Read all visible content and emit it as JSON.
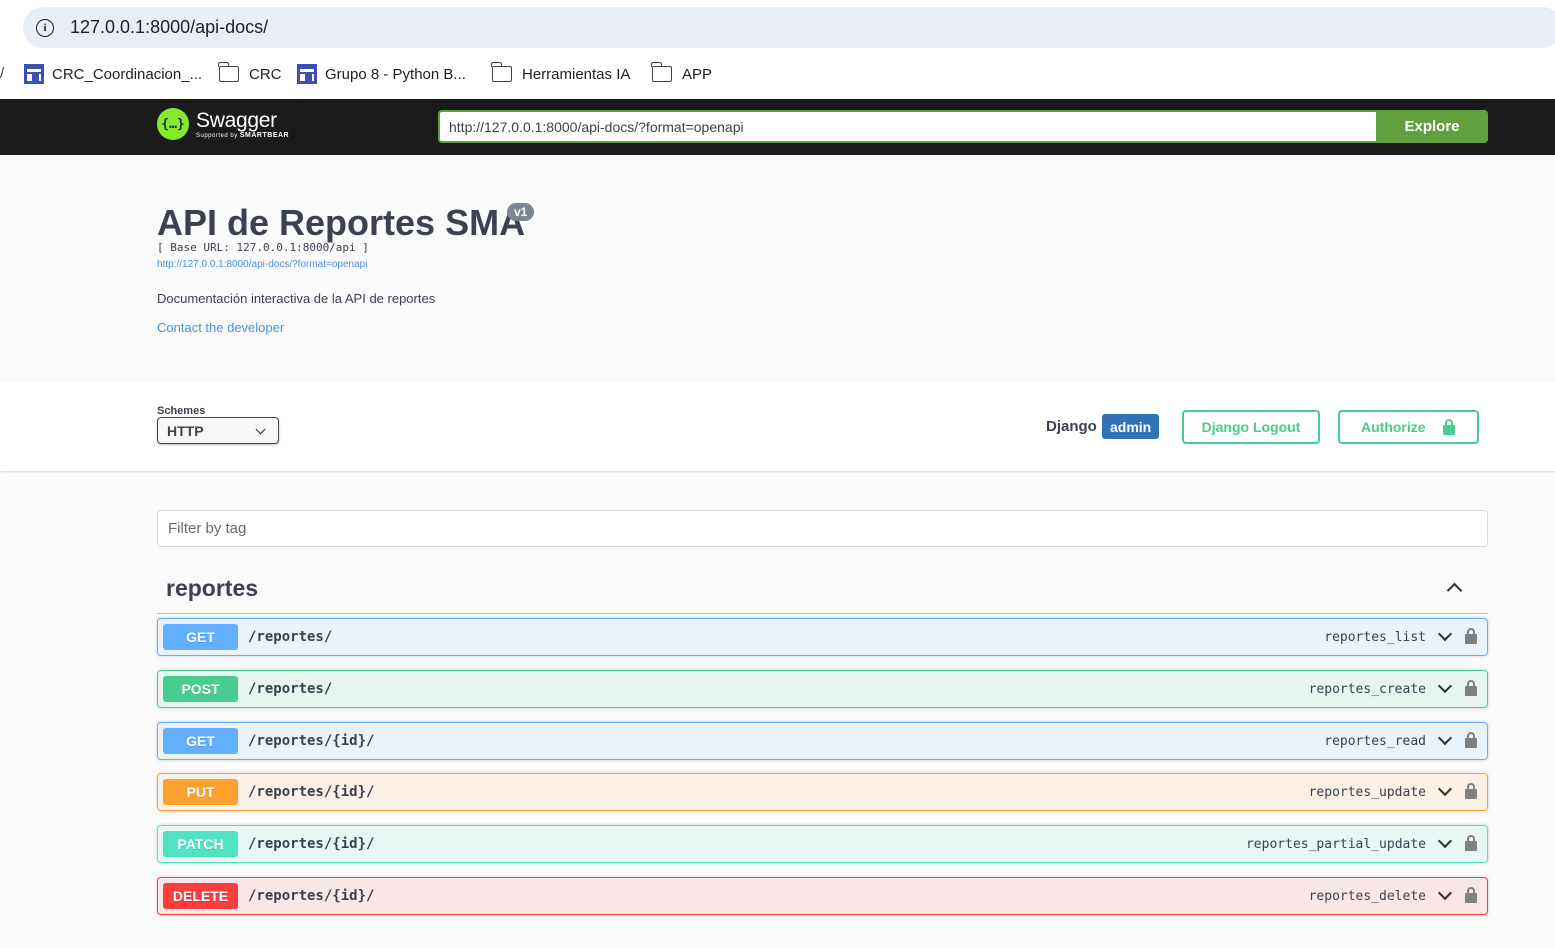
{
  "browser": {
    "address": "127.0.0.1:8000/api-docs/",
    "bookmarks": [
      {
        "label": "CRC_Coordinacion_...",
        "type": "sheet"
      },
      {
        "label": "CRC",
        "type": "folder"
      },
      {
        "label": "Grupo 8 - Python B...",
        "type": "sheet"
      },
      {
        "label": "Herramientas IA",
        "type": "folder"
      },
      {
        "label": "APP",
        "type": "folder"
      }
    ]
  },
  "topbar": {
    "logo_word": "Swagger",
    "logo_sub_prefix": "Supported by",
    "logo_sub_brand": "SMARTBEAR",
    "spec_url": "http://127.0.0.1:8000/api-docs/?format=openapi",
    "explore_label": "Explore"
  },
  "info": {
    "title": "API de Reportes SMA",
    "version": "v1",
    "base_url": "[ Base URL: 127.0.0.1:8000/api ]",
    "spec_link": "http://127.0.0.1:8000/api-docs/?format=openapi",
    "description": "Documentación interactiva de la API de reportes",
    "contact": "Contact the developer"
  },
  "scheme": {
    "label": "Schemes",
    "selected": "HTTP",
    "django_label": "Django",
    "django_user": "admin",
    "logout_label": "Django Logout",
    "authorize_label": "Authorize"
  },
  "filter": {
    "placeholder": "Filter by tag"
  },
  "tag": {
    "name": "reportes"
  },
  "operations": [
    {
      "method": "GET",
      "path": "/reportes/",
      "operation_id": "reportes_list"
    },
    {
      "method": "POST",
      "path": "/reportes/",
      "operation_id": "reportes_create"
    },
    {
      "method": "GET",
      "path": "/reportes/{id}/",
      "operation_id": "reportes_read"
    },
    {
      "method": "PUT",
      "path": "/reportes/{id}/",
      "operation_id": "reportes_update"
    },
    {
      "method": "PATCH",
      "path": "/reportes/{id}/",
      "operation_id": "reportes_partial_update"
    },
    {
      "method": "DELETE",
      "path": "/reportes/{id}/",
      "operation_id": "reportes_delete"
    }
  ],
  "colors": {
    "get": "#61affe",
    "post": "#49cc90",
    "put": "#fca130",
    "patch": "#50e3c2",
    "delete": "#f93e3e",
    "topbar": "#1b1b1b",
    "explore": "#62a03f",
    "link": "#4990e2"
  }
}
